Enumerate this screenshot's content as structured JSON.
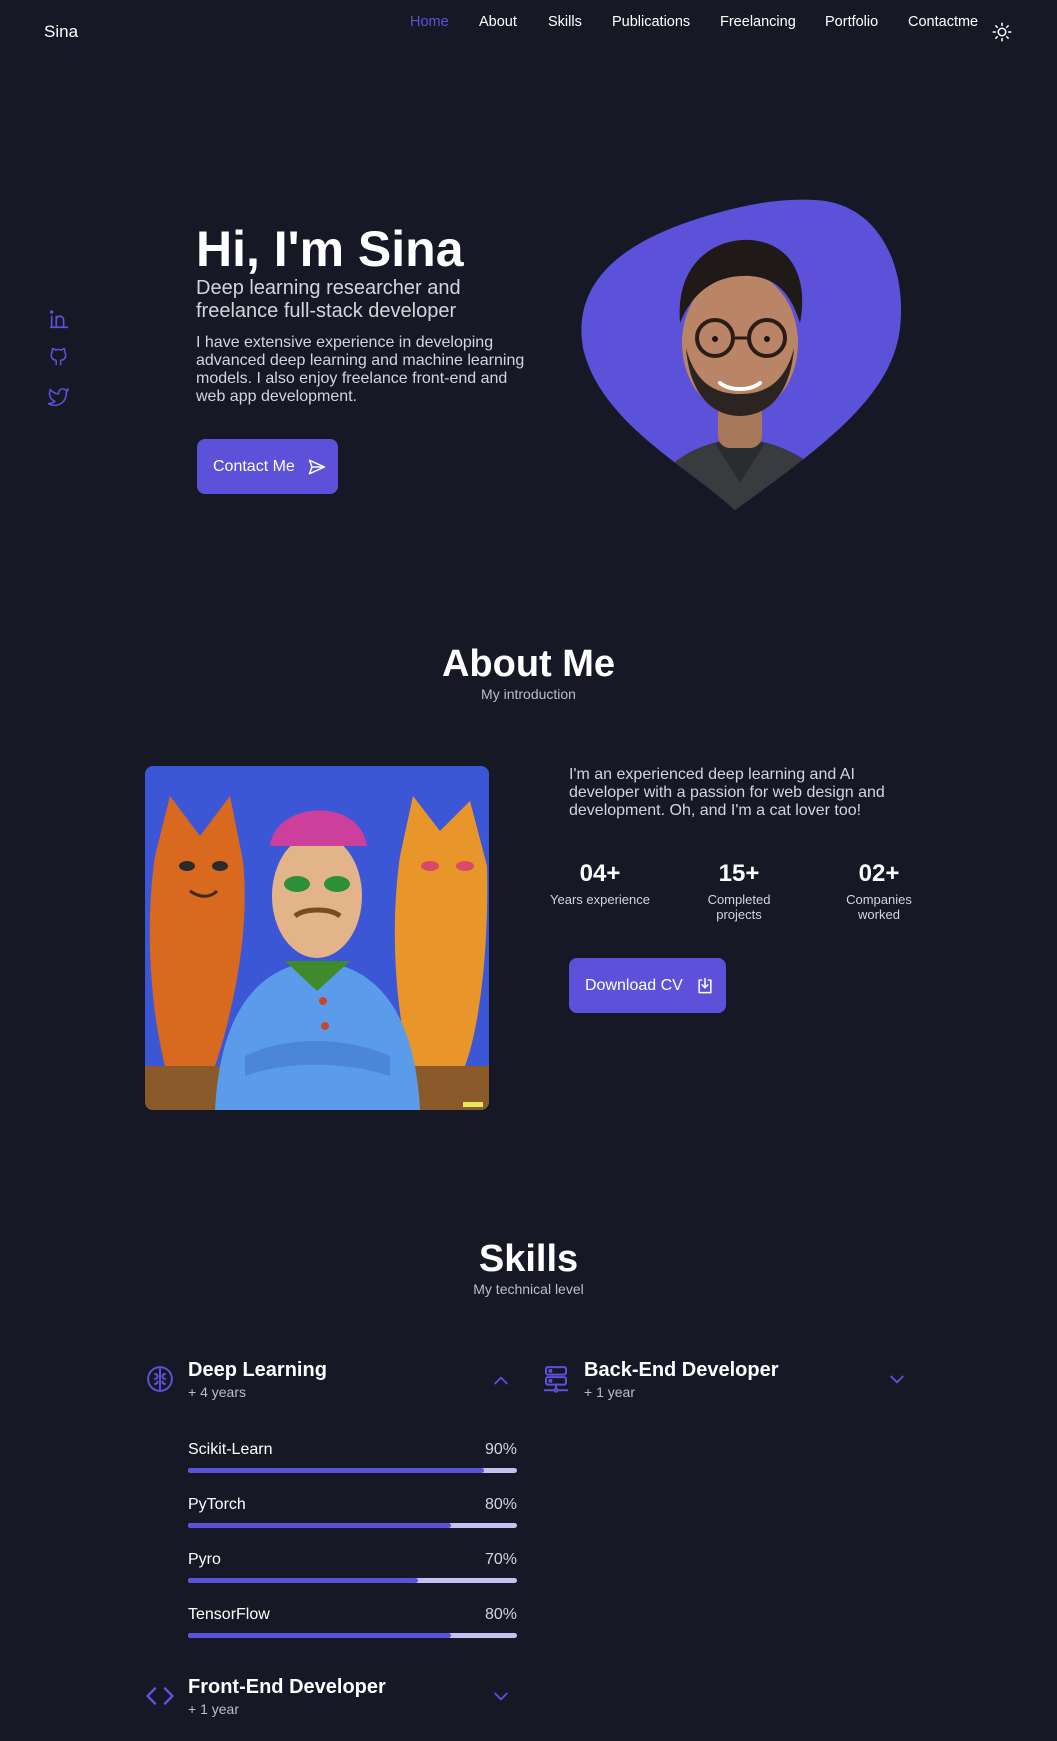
{
  "header": {
    "logo": "Sina",
    "nav": [
      "Home",
      "About",
      "Skills",
      "Publications",
      "Freelancing",
      "Portfolio",
      "Contactme"
    ],
    "active_nav": "Home",
    "theme_icon": "sun-icon"
  },
  "social": [
    "linkedin-icon",
    "github-icon",
    "twitter-icon"
  ],
  "hero": {
    "title": "Hi, I'm Sina",
    "subtitle": "Deep learning researcher and freelance full-stack developer",
    "description": "I have extensive experience in developing advanced deep learning and machine learning models. I also enjoy freelance front-end and web app development.",
    "button_label": "Contact Me"
  },
  "about": {
    "title": "About Me",
    "subtitle": "My introduction",
    "description": "I'm an experienced deep learning and AI developer with a passion for web design and development. Oh, and I'm a cat lover too!",
    "stats": [
      {
        "value": "04+",
        "label": "Years experience"
      },
      {
        "value": "15+",
        "label": "Completed projects"
      },
      {
        "value": "02+",
        "label": "Companies worked"
      }
    ],
    "button_label": "Download CV"
  },
  "skills": {
    "title": "Skills",
    "subtitle": "My technical level",
    "groups": [
      {
        "name": "Deep Learning",
        "years": "+ 4 years",
        "expanded": true,
        "items": [
          {
            "name": "Scikit-Learn",
            "percent_label": "90%",
            "percent": 90
          },
          {
            "name": "PyTorch",
            "percent_label": "80%",
            "percent": 80
          },
          {
            "name": "Pyro",
            "percent_label": "70%",
            "percent": 70
          },
          {
            "name": "TensorFlow",
            "percent_label": "80%",
            "percent": 80
          }
        ]
      },
      {
        "name": "Back-End Developer",
        "years": "+ 1 year",
        "expanded": false
      },
      {
        "name": "Front-End Developer",
        "years": "+ 1 year",
        "expanded": false
      }
    ]
  },
  "colors": {
    "background": "#171826",
    "accent": "#5b52d9"
  }
}
